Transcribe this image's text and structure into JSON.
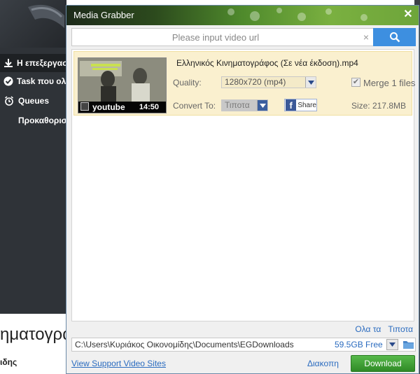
{
  "background_app": {
    "nav": [
      {
        "label": "Η επεξεργασία",
        "icon": "download-icon"
      },
      {
        "label": "Task που ολοκληρώθηκαν",
        "icon": "check-circle-icon"
      },
      {
        "label": "Queues",
        "icon": "alarm-clock-icon"
      },
      {
        "label": "Προκαθορισμένα",
        "icon": ""
      }
    ],
    "content_title": "ηματογράφος",
    "content_sub": "ιδης"
  },
  "dialog": {
    "title": "Media Grabber",
    "url_placeholder": "Please input video url",
    "clear_symbol": "×",
    "item": {
      "filename": "Ελληνικός Κινηματογράφος (Σε νέα έκδοση).mp4",
      "source": "youtube",
      "duration": "14:50",
      "quality_label": "Quality:",
      "quality_value": "1280x720 (mp4)",
      "convert_label": "Convert To:",
      "convert_value": "Τιποτα",
      "merge_label": "Merge 1 files",
      "merge_checked": true,
      "share_label": "Share",
      "size": "Size: 217.8MB"
    },
    "select_all": "Ολα τα",
    "select_none": "Τιποτα",
    "save_path": "C:\\Users\\Κυριάκος Οικονομίδης\\Documents\\EGDownloads",
    "free_space": "59.5GB Free",
    "support_link": "View Support Video Sites",
    "cancel": "Διακοπη",
    "download": "Download"
  },
  "colors": {
    "accent_blue": "#3d8fe0",
    "download_green": "#3a9a30",
    "item_highlight": "#faf0cf",
    "link_blue": "#2a6bbf"
  }
}
